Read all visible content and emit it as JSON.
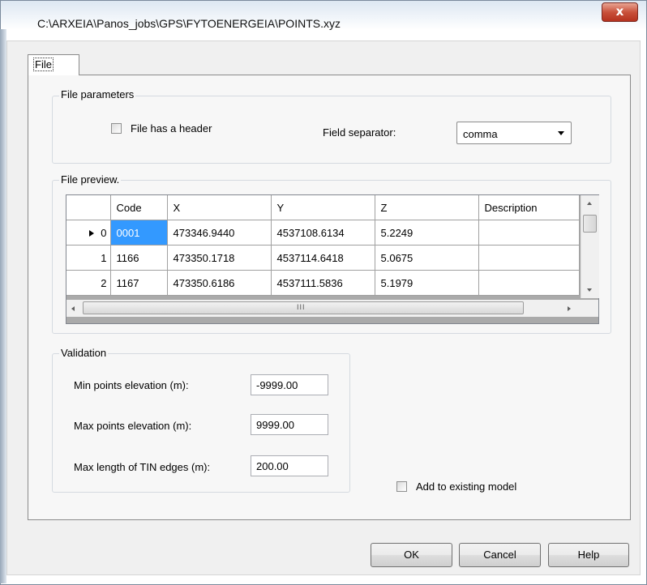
{
  "window": {
    "title": "C:\\ARXEIA\\Panos_jobs\\GPS\\FYTOENERGEIA\\POINTS.xyz",
    "close_label": "x"
  },
  "tabs": [
    {
      "label": "File",
      "selected": true
    }
  ],
  "file_parameters": {
    "group_label": "File parameters",
    "has_header_label": "File has a header",
    "has_header_checked": false,
    "separator_label": "Field separator:",
    "separator_value": "comma"
  },
  "preview": {
    "group_label": "File preview.",
    "columns": [
      "Code",
      "X",
      "Y",
      "Z",
      "Description"
    ],
    "rows": [
      {
        "index": "0",
        "current": true,
        "cells": [
          "0001",
          "473346.9440",
          "4537108.6134",
          "5.2249",
          ""
        ]
      },
      {
        "index": "1",
        "current": false,
        "cells": [
          "1166",
          "473350.1718",
          "4537114.6418",
          "5.0675",
          ""
        ]
      },
      {
        "index": "2",
        "current": false,
        "cells": [
          "1167",
          "473350.6186",
          "4537111.5836",
          "5.1979",
          ""
        ]
      }
    ],
    "scroll_grip": "III"
  },
  "validation": {
    "group_label": "Validation",
    "min_label": "Min points elevation (m):",
    "min_value": "-9999.00",
    "max_label": "Max points elevation (m):",
    "max_value": "9999.00",
    "tin_label": "Max length of TIN edges (m):",
    "tin_value": "200.00"
  },
  "add_existing": {
    "label": "Add to existing model",
    "checked": false
  },
  "buttons": {
    "ok": "OK",
    "cancel": "Cancel",
    "help": "Help"
  },
  "colors": {
    "selection": "#3399ff",
    "close_button": "#c9513b"
  }
}
